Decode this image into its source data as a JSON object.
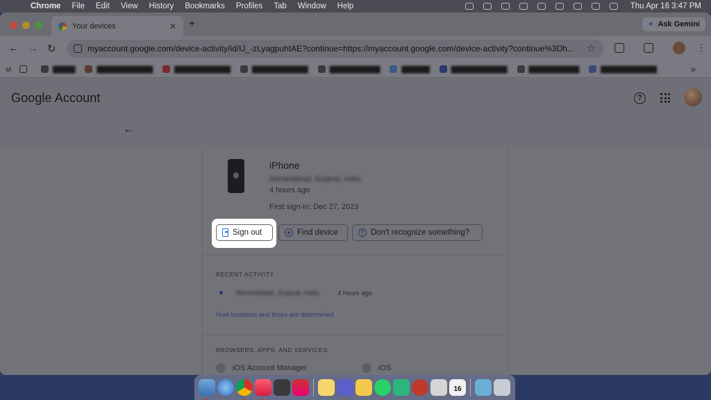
{
  "menubar": {
    "items": [
      "Chrome",
      "File",
      "Edit",
      "View",
      "History",
      "Bookmarks",
      "Profiles",
      "Tab",
      "Window",
      "Help"
    ],
    "clock": "Thu Apr 16  3:47 PM"
  },
  "tabs": [
    {
      "title": "Your devices"
    }
  ],
  "ask_gemini": "Ask Gemini",
  "omnibox": {
    "url": "myaccount.google.com/device-activity/id/IJ_-zLyagpuhtAE?continue=https://myaccount.google.com/device-activity?continue%3Dh..."
  },
  "bookmarks": {
    "first_label": "st"
  },
  "header": {
    "logo_brand": "Google",
    "logo_product": "Account"
  },
  "device": {
    "name": "iPhone",
    "location": "Ahmedabad, Gujarat, India",
    "last_seen": "4 hours ago",
    "first_signin": "First sign-in: Dec 27, 2023"
  },
  "actions": {
    "sign_out": "Sign out",
    "find_device": "Find device",
    "dont_recognize": "Don't recognize something?"
  },
  "recent_activity": {
    "title": "RECENT ACTIVITY",
    "location": "Ahmedabad, Gujarat, India",
    "time": "4 hours ago",
    "link": "How locations and times are determined"
  },
  "services": {
    "title": "BROWSERS, APPS, AND SERVICES",
    "items": [
      "iOS Account Manager",
      "iOS"
    ]
  },
  "dock": {
    "calendar_day": "16"
  }
}
